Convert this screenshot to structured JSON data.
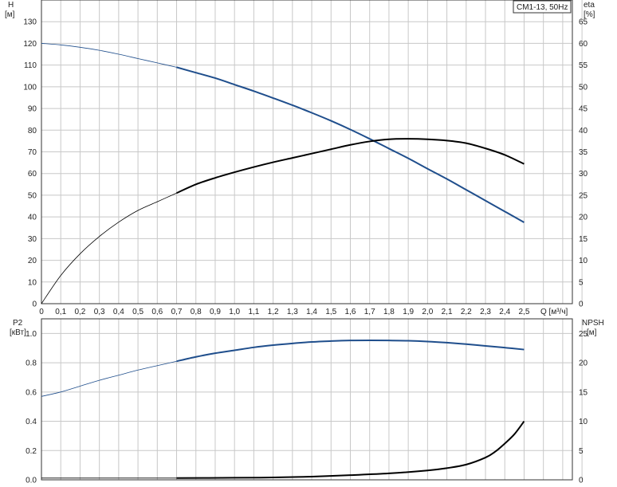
{
  "legend_label": "CM1-13, 50Hz",
  "chart_data": [
    {
      "type": "line",
      "panel": "top",
      "title": "",
      "xlabel": "Q [м³/ч]",
      "x_ticks": [
        "0",
        "0,1",
        "0,2",
        "0,3",
        "0,4",
        "0,5",
        "0,6",
        "0,7",
        "0,8",
        "0,9",
        "1,0",
        "1,1",
        "1,2",
        "1,3",
        "1,4",
        "1,5",
        "1,6",
        "1,7",
        "1,8",
        "1,9",
        "2,0",
        "2,1",
        "2,2",
        "2,3",
        "2,4",
        "2,5"
      ],
      "x_unit_label": "Q [м³/ч]",
      "y_left": {
        "label": "H",
        "unit": "[м]",
        "ticks": [
          "0",
          "10",
          "20",
          "30",
          "40",
          "50",
          "60",
          "70",
          "80",
          "90",
          "100",
          "110",
          "120",
          "130"
        ],
        "ylim": [
          0,
          140
        ]
      },
      "y_right": {
        "label": "eta",
        "unit": "[%]",
        "ticks": [
          "0",
          "5",
          "10",
          "15",
          "20",
          "25",
          "30",
          "35",
          "40",
          "45",
          "50",
          "55",
          "60",
          "65"
        ],
        "ylim": [
          0,
          70
        ]
      },
      "grid": true,
      "xlim": [
        0,
        2.75
      ],
      "series": [
        {
          "axis": "left",
          "color": "#1f4e8c",
          "thin_until": 0.7,
          "x": [
            0,
            0.1,
            0.2,
            0.3,
            0.4,
            0.5,
            0.6,
            0.7,
            0.8,
            0.9,
            1.0,
            1.1,
            1.2,
            1.3,
            1.4,
            1.5,
            1.6,
            1.7,
            1.8,
            1.9,
            2.0,
            2.1,
            2.2,
            2.3,
            2.4,
            2.5
          ],
          "y": [
            120,
            119.3,
            118.2,
            116.8,
            115,
            113,
            111,
            109,
            106.5,
            104,
            101,
            98,
            94.8,
            91.5,
            88,
            84.3,
            80.3,
            76,
            71.5,
            67,
            62.2,
            57.5,
            52.5,
            47.5,
            42.5,
            37.5
          ]
        },
        {
          "axis": "right",
          "color": "#000000",
          "thin_until": 0.7,
          "x": [
            0,
            0.1,
            0.2,
            0.3,
            0.4,
            0.5,
            0.6,
            0.7,
            0.8,
            0.9,
            1.0,
            1.1,
            1.2,
            1.3,
            1.4,
            1.5,
            1.6,
            1.7,
            1.8,
            1.9,
            2.0,
            2.1,
            2.2,
            2.3,
            2.4,
            2.5
          ],
          "y": [
            0,
            6.5,
            11.5,
            15.5,
            18.8,
            21.5,
            23.5,
            25.5,
            27.5,
            29,
            30.3,
            31.5,
            32.6,
            33.6,
            34.6,
            35.6,
            36.6,
            37.4,
            37.9,
            38,
            37.9,
            37.6,
            37,
            35.8,
            34.3,
            32.2
          ]
        }
      ]
    },
    {
      "type": "line",
      "panel": "bottom",
      "title": "",
      "xlabel": "",
      "y_left": {
        "label": "P2",
        "unit": "[кВт]",
        "ticks": [
          "0.0",
          "0.2",
          "0.4",
          "0.6",
          "0.8",
          "1.0"
        ],
        "ylim": [
          0,
          1.1
        ]
      },
      "y_right": {
        "label": "NPSH",
        "unit": "[м]",
        "ticks": [
          "0",
          "5",
          "10",
          "15",
          "20",
          "25"
        ],
        "ylim": [
          0,
          27.5
        ]
      },
      "grid": true,
      "xlim": [
        0,
        2.75
      ],
      "series": [
        {
          "axis": "left",
          "color": "#1f4e8c",
          "thin_until": 0.7,
          "x": [
            0,
            0.1,
            0.2,
            0.3,
            0.4,
            0.5,
            0.6,
            0.7,
            0.8,
            0.9,
            1.0,
            1.1,
            1.2,
            1.3,
            1.4,
            1.5,
            1.6,
            1.7,
            1.8,
            1.9,
            2.0,
            2.1,
            2.2,
            2.3,
            2.4,
            2.5
          ],
          "y": [
            0.57,
            0.6,
            0.64,
            0.68,
            0.715,
            0.75,
            0.78,
            0.81,
            0.84,
            0.865,
            0.885,
            0.905,
            0.92,
            0.932,
            0.942,
            0.948,
            0.952,
            0.953,
            0.952,
            0.95,
            0.945,
            0.937,
            0.927,
            0.915,
            0.903,
            0.89
          ]
        },
        {
          "axis": "right",
          "color": "#000000",
          "thin_until": 0.7,
          "x": [
            0,
            0.5,
            0.7,
            1.0,
            1.2,
            1.4,
            1.6,
            1.8,
            2.0,
            2.1,
            2.2,
            2.3,
            2.35,
            2.4,
            2.45,
            2.5
          ],
          "y": [
            0.3,
            0.3,
            0.3,
            0.35,
            0.4,
            0.55,
            0.8,
            1.1,
            1.6,
            2.0,
            2.6,
            3.8,
            4.8,
            6.2,
            7.8,
            10.0
          ]
        }
      ]
    }
  ]
}
